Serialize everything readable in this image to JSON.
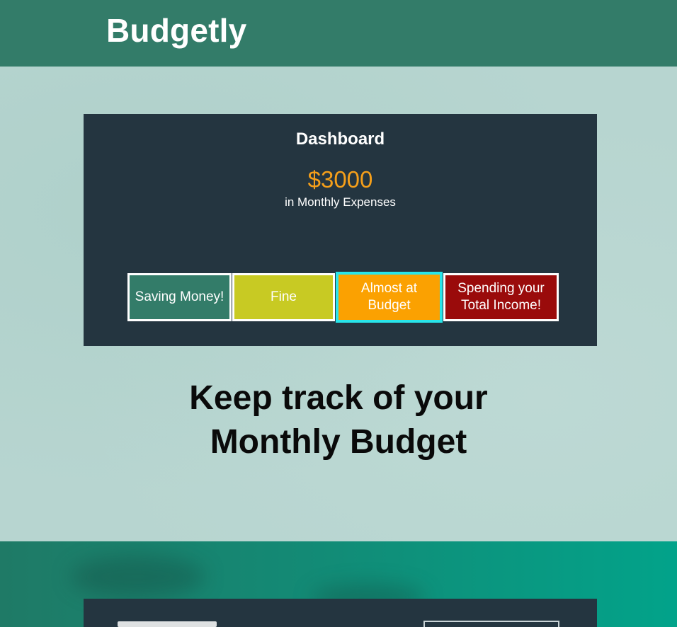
{
  "header": {
    "brand": "Budgetly",
    "background_color": "#337c69"
  },
  "dashboard": {
    "title": "Dashboard",
    "amount": "$3000",
    "amount_color": "#f59f1a",
    "subtitle": "in Monthly Expenses",
    "statuses": [
      {
        "label": "Saving Money!",
        "color": "#337c69",
        "selected": false
      },
      {
        "label": "Fine",
        "color": "#c8ca23",
        "selected": false
      },
      {
        "label": "Almost at Budget",
        "color": "#fba101",
        "selected": true
      },
      {
        "label": "Spending your Total Income!",
        "color": "#9a0b0b",
        "selected": false
      }
    ]
  },
  "hero": {
    "tagline_line1": "Keep track of your",
    "tagline_line2": "Monthly Budget"
  }
}
